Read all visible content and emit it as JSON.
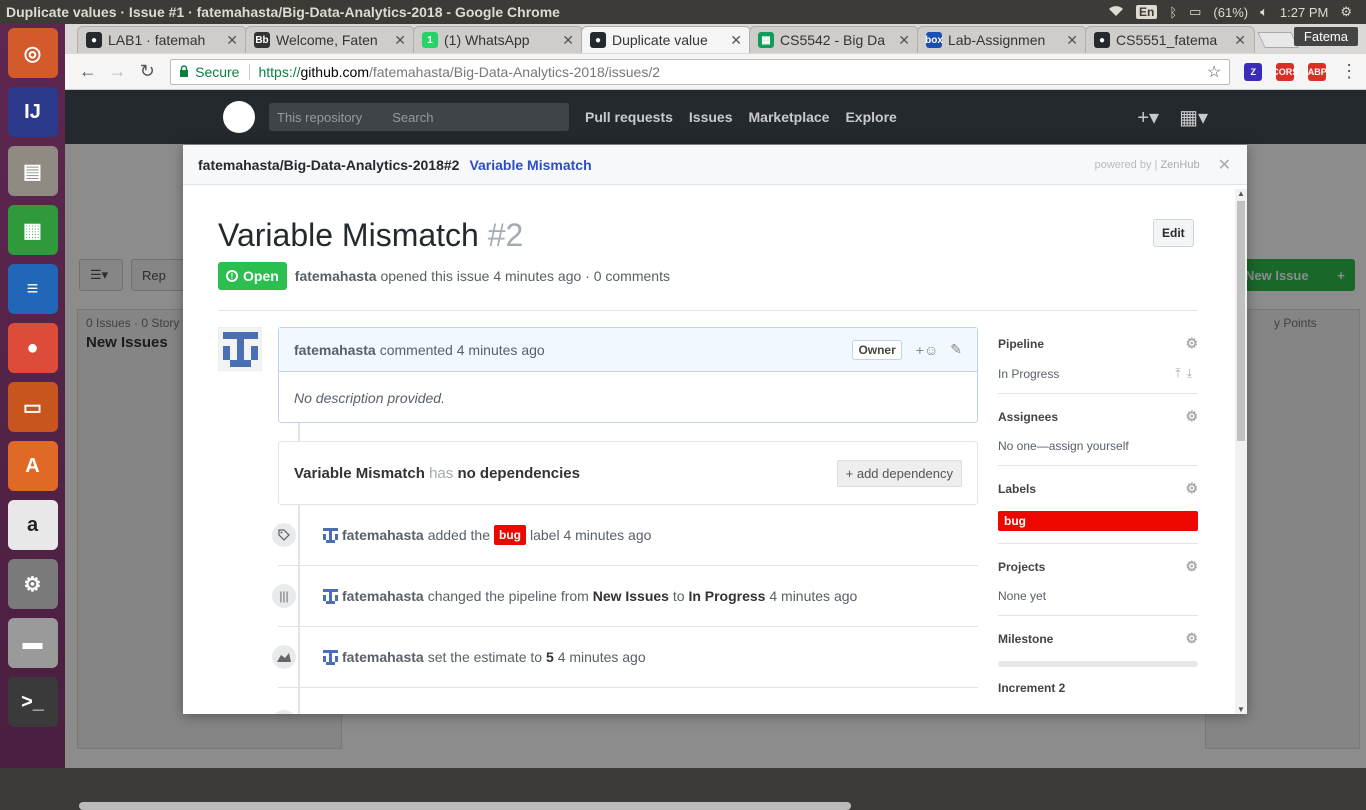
{
  "os": {
    "window_title": "Duplicate values · Issue #1 · fatemahasta/Big-Data-Analytics-2018 - Google Chrome",
    "keyboard_layout": "En",
    "battery": "(61%)",
    "clock": "1:27 PM",
    "launcher": [
      {
        "name": "ubuntu-dash-icon",
        "color": "#d35a2b",
        "glyph": "◎"
      },
      {
        "name": "intellij-icon",
        "color": "#2b3a8a",
        "glyph": "IJ"
      },
      {
        "name": "files-icon",
        "color": "#8f8a82",
        "glyph": "▤"
      },
      {
        "name": "calc-icon",
        "color": "#2e9a3c",
        "glyph": "▦"
      },
      {
        "name": "writer-icon",
        "color": "#2266b8",
        "glyph": "≡"
      },
      {
        "name": "chrome-icon",
        "color": "#dd4b39",
        "glyph": "●"
      },
      {
        "name": "impress-icon",
        "color": "#c8541e",
        "glyph": "▭"
      },
      {
        "name": "software-center-icon",
        "color": "#e06a25",
        "glyph": "A"
      },
      {
        "name": "amazon-icon",
        "color": "#e8e8e8",
        "glyph": "a"
      },
      {
        "name": "system-settings-icon",
        "color": "#7a7a7a",
        "glyph": "⚙"
      },
      {
        "name": "drive-icon",
        "color": "#9a9a9a",
        "glyph": "▬"
      },
      {
        "name": "terminal-icon",
        "color": "#3a3a3a",
        "glyph": ">_"
      }
    ]
  },
  "chrome": {
    "profile_name": "Fatema",
    "tabs": [
      {
        "label": "LAB1 · fatemah",
        "fav_color": "#24292e",
        "fav_glyph": "●"
      },
      {
        "label": "Welcome, Faten",
        "fav_color": "#333",
        "fav_glyph": "Bb"
      },
      {
        "label": "(1) WhatsApp",
        "fav_color": "#25d366",
        "fav_glyph": "1"
      },
      {
        "label": "Duplicate value",
        "fav_color": "#24292e",
        "fav_glyph": "●"
      },
      {
        "label": "CS5542 - Big Da",
        "fav_color": "#0f9d58",
        "fav_glyph": "▦"
      },
      {
        "label": "Lab-Assignmen",
        "fav_color": "#1a4fb4",
        "fav_glyph": "box"
      },
      {
        "label": "CS5551_fatema",
        "fav_color": "#24292e",
        "fav_glyph": "●"
      }
    ],
    "secure_label": "Secure",
    "url_scheme": "https://",
    "url_host": "github.com",
    "url_path": "/fatemahasta/Big-Data-Analytics-2018/issues/2",
    "extensions": [
      {
        "name": "zenhub-ext-icon",
        "color": "#3a2bb8",
        "glyph": "Z"
      },
      {
        "name": "cors-ext-icon",
        "color": "#d93025",
        "glyph": "CORS"
      },
      {
        "name": "adblock-ext-icon",
        "color": "#d93025",
        "glyph": "ABP"
      }
    ]
  },
  "github": {
    "search_scope": "This repository",
    "search_placeholder": "Search",
    "nav": [
      "Pull requests",
      "Issues",
      "Marketplace",
      "Explore"
    ],
    "bg_repos_btn": "Rep",
    "bg_new_issue": "New Issue",
    "bg_col_count": "0 Issues · 0 Story",
    "bg_col_name": "New Issues",
    "bg_story_points": "y Points"
  },
  "modal": {
    "repo_ref": "fatemahasta/Big-Data-Analytics-2018#2",
    "issue_link": "Variable Mismatch",
    "powered_by": "powered by |",
    "powered_brand": "ZenHub",
    "title": "Variable Mismatch",
    "number": "#2",
    "edit_label": "Edit",
    "state": "Open",
    "author": "fatemahasta",
    "opened_text": "opened this issue 4 minutes ago · 0 comments",
    "comment": {
      "author": "fatemahasta",
      "meta": "commented 4 minutes ago",
      "owner_badge": "Owner",
      "body": "No description provided."
    },
    "deps": {
      "title": "Variable Mismatch",
      "has": "has",
      "none": "no dependencies",
      "add": "+ add dependency"
    },
    "events": [
      {
        "who": "fatemahasta",
        "pre": "added the",
        "label": "bug",
        "post": "label 4 minutes ago"
      },
      {
        "who": "fatemahasta",
        "pre": "changed the pipeline from",
        "b1": "New Issues",
        "mid": "to",
        "b2": "In Progress",
        "post": "4 minutes ago"
      },
      {
        "who": "fatemahasta",
        "pre": "set the estimate to",
        "b1": "5",
        "post": "4 minutes ago"
      }
    ],
    "sidebar": {
      "pipeline_title": "Pipeline",
      "pipeline_value": "In Progress",
      "assignees_title": "Assignees",
      "assignees_value": "No one—assign yourself",
      "labels_title": "Labels",
      "label_bug": "bug",
      "projects_title": "Projects",
      "projects_value": "None yet",
      "milestone_title": "Milestone",
      "milestone_value": "Increment 2"
    }
  }
}
